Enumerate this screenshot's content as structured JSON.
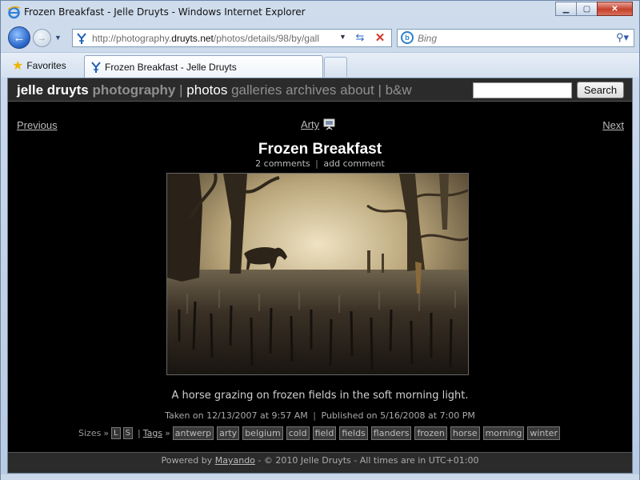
{
  "window": {
    "title": "Frozen Breakfast - Jelle Druyts - Windows Internet Explorer",
    "minimize": "▁",
    "maximize": "▢",
    "close": "✕"
  },
  "nav": {
    "address_prefix": "http://photography.",
    "address_domain": "druyts.net",
    "address_path": "/photos/details/98/by/gall",
    "search_placeholder": "Bing"
  },
  "favorites": {
    "label": "Favorites"
  },
  "tab": {
    "label": "Frozen Breakfast - Jelle Druyts"
  },
  "site": {
    "brand_first": "jelle druyts",
    "brand_second": "photography",
    "menu": [
      {
        "label": "photos"
      },
      {
        "label": "galleries"
      },
      {
        "label": "archives"
      },
      {
        "label": "about"
      },
      {
        "label": "b&w"
      }
    ],
    "search_button": "Search"
  },
  "photo_nav": {
    "previous": "Previous",
    "category": "Arty",
    "next": "Next"
  },
  "photo": {
    "title": "Frozen Breakfast",
    "comments_link": "2 comments",
    "add_comment_link": "add comment",
    "caption": "A horse grazing on frozen fields in the soft morning light.",
    "taken": "Taken on 12/13/2007 at 9:57 AM",
    "published": "Published on 5/16/2008 at 7:00 PM"
  },
  "meta": {
    "sizes_label": "Sizes",
    "sizes": [
      "L",
      "S"
    ],
    "tags_label": "Tags",
    "tags": [
      "antwerp",
      "arty",
      "belgium",
      "cold",
      "field",
      "fields",
      "flanders",
      "frozen",
      "horse",
      "morning",
      "winter"
    ]
  },
  "footer": {
    "powered_by": "Powered by",
    "mayando": "Mayando",
    "rest": "- © 2010 Jelle Druyts - All times are in UTC+01:00"
  },
  "colors": {
    "page_bg": "#000000",
    "header_bg": "#2b2b2b",
    "link_gray": "#8f8f8f",
    "text_light": "#bbbbbb"
  }
}
